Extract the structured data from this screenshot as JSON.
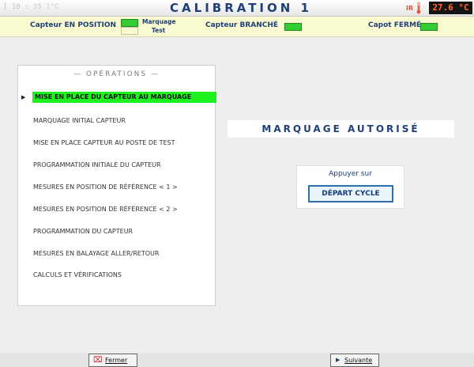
{
  "header": {
    "time": "[ 10 : 35 ]°C",
    "title": "CALIBRATION 1",
    "sensor_label": "IR",
    "temperature": "27.6 °C"
  },
  "status": {
    "capteur_position": "Capteur EN POSITION",
    "marquage": "Marquage",
    "test": "Test",
    "capteur_branche": "Capteur BRANCHÉ",
    "capot_ferme": "Capot FERMÉ"
  },
  "operations": {
    "header": "— OPÉRATIONS —",
    "active_index": 0,
    "items": [
      {
        "label": "MISE EN PLACE DU CAPTEUR AU MARQUAGE"
      },
      {
        "label": "MARQUAGE INITIAL CAPTEUR"
      },
      {
        "label": "MISE EN PLACE CAPTEUR AU POSTE DE TEST"
      },
      {
        "label": "PROGRAMMATION INITIALE DU CAPTEUR"
      },
      {
        "label": "MESURES EN POSITION DE RÉFÉRENCE  < 1 >"
      },
      {
        "label": "MESURES EN POSITION DE RÉFÉRENCE  < 2 >"
      },
      {
        "label": "PROGRAMMATION DU CAPTEUR"
      },
      {
        "label": "MESURES EN BALAYAGE ALLER/RETOUR"
      },
      {
        "label": "CALCULS ET VÉRIFICATIONS"
      }
    ]
  },
  "main": {
    "banner": "MARQUAGE AUTORISÉ",
    "prompt": "Appuyer sur",
    "depart_button": "DÉPART CYCLE"
  },
  "footer": {
    "fermer": "Fermer",
    "suivante": "Suivante"
  },
  "colors": {
    "accent_blue": "#1f3f78",
    "led_green": "#33cc33",
    "active_green": "#1ef21e",
    "temperature_orange": "#ff6a2b"
  },
  "icons": {
    "thermometer": "thermometer-icon",
    "marker": "play-marker-icon",
    "close": "close-icon",
    "next": "play-icon"
  }
}
